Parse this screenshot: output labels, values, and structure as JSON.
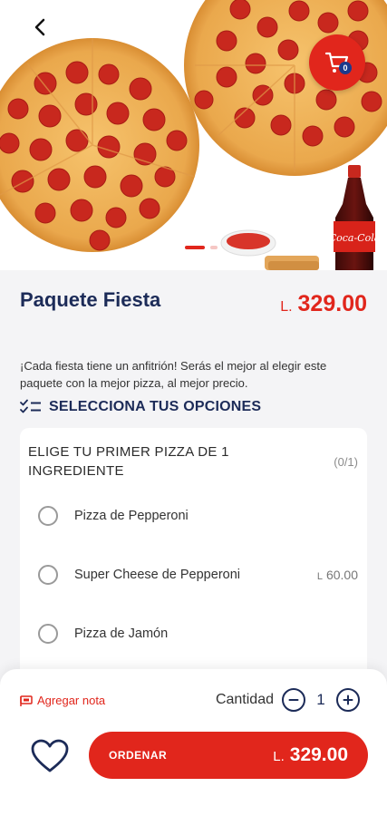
{
  "hero": {
    "cart_count": "0",
    "bottle_label": "Coca-Cola",
    "slide_count": 2,
    "active_slide": 0
  },
  "product": {
    "title": "Paquete Fiesta",
    "currency": "L.",
    "price": "329.00",
    "description": "¡Cada fiesta tiene un anfitrión! Serás el mejor al elegir este paquete con la mejor pizza, al mejor precio."
  },
  "options_header": "SELECCIONA TUS OPCIONES",
  "option_group": {
    "title": "ELIGE TU PRIMER PIZZA DE 1 INGREDIENTE",
    "count": "(0/1)",
    "items": [
      {
        "label": "Pizza de Pepperoni",
        "price": "",
        "currency": ""
      },
      {
        "label": "Super Cheese de Pepperoni",
        "price": "60.00",
        "currency": "L"
      },
      {
        "label": "Pizza de Jamón",
        "price": "",
        "currency": ""
      }
    ]
  },
  "bottom_bar": {
    "note_label": "Agregar nota",
    "quantity_label": "Cantidad",
    "quantity": "1",
    "order_label": "ORDENAR",
    "order_currency": "L.",
    "order_price": "329.00"
  },
  "colors": {
    "brand_red": "#e1261c",
    "navy": "#1c2b58",
    "badge_blue": "#1b3a8c",
    "background": "#f4f4f6"
  },
  "icons": [
    "back-arrow-icon",
    "cart-icon",
    "checklist-icon",
    "note-flag-icon",
    "minus-icon",
    "plus-icon",
    "heart-icon"
  ]
}
